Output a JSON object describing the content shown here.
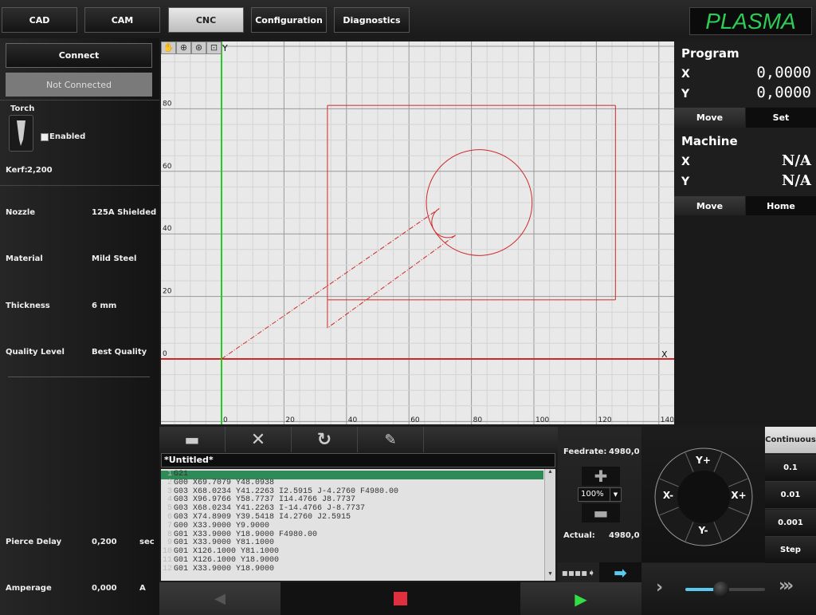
{
  "tabs": [
    {
      "label": "CAD"
    },
    {
      "label": "CAM"
    },
    {
      "label": "CNC",
      "active": true
    },
    {
      "label": "Configuration"
    },
    {
      "label": "Diagnostics"
    }
  ],
  "logo": "PLASMA",
  "left": {
    "connect": "Connect",
    "status": "Not Connected",
    "torch_label": "Torch",
    "enabled_label": "Enabled",
    "enabled": false,
    "kerf_label": "Kerf:",
    "kerf": "2,200",
    "params": [
      {
        "label": "Nozzle",
        "value": "125A Shielded"
      },
      {
        "label": "Material",
        "value": "Mild Steel"
      },
      {
        "label": "Thickness",
        "value": "6 mm"
      },
      {
        "label": "Quality Level",
        "value": "Best Quality"
      }
    ],
    "pierce": {
      "label": "Pierce Delay",
      "value": "0,200",
      "unit": "sec"
    },
    "amperage": {
      "label": "Amperage",
      "value": "0,000",
      "unit": "A"
    }
  },
  "canvas": {
    "tools": [
      "pan-icon",
      "zoom-in-icon",
      "zoom-dynamic-icon",
      "zoom-fit-icon"
    ],
    "x_axis_label": "X",
    "y_axis_label": "Y",
    "x_ticks": [
      0,
      20,
      40,
      60,
      80,
      100,
      120,
      140
    ],
    "y_ticks": [
      0,
      20,
      40,
      60,
      80
    ],
    "path_color": "#d02828",
    "x_axis_color": "#d02828",
    "y_axis_color": "#22cc22"
  },
  "program": {
    "title": "Program",
    "x_label": "X",
    "x": "0,0000",
    "y_label": "Y",
    "y": "0,0000",
    "move": "Move",
    "set": "Set"
  },
  "machine": {
    "title": "Machine",
    "x_label": "X",
    "x": "N/A",
    "y_label": "Y",
    "y": "N/A",
    "move": "Move",
    "home": "Home"
  },
  "editor": {
    "toolbar": [
      "open-folder-icon",
      "close-icon",
      "reload-icon",
      "edit-icon"
    ],
    "title": "*Untitled*",
    "lines": [
      "G21",
      "G00 X69.7079 Y48.0938",
      "G03 X68.0234 Y41.2263 I2.5915 J-4.2760 F4980.00",
      "G03 X96.9766 Y58.7737 I14.4766 J8.7737",
      "G03 X68.0234 Y41.2263 I-14.4766 J-8.7737",
      "G03 X74.8909 Y39.5418 I4.2760 J2.5915",
      "G00 X33.9000 Y9.9000",
      "G01 X33.9000 Y18.9000 F4980.00",
      "G01 X33.9000 Y81.1000",
      "G01 X126.1000 Y81.1000",
      "G01 X126.1000 Y18.9000",
      "G01 X33.9000 Y18.9000"
    ],
    "selected_line": 1
  },
  "feed": {
    "feedrate_label": "Feedrate:",
    "feedrate": "4980,0",
    "override": "100%",
    "actual_label": "Actual:",
    "actual": "4980,0"
  },
  "jog": {
    "yplus": "Y+",
    "yminus": "Y-",
    "xplus": "X+",
    "xminus": "X-",
    "modes": [
      "Continuous",
      "0.1",
      "0.01",
      "0.001",
      "Step"
    ],
    "active_mode": "Continuous",
    "speed_fraction": 0.45
  },
  "accent": "#5bc8f0"
}
